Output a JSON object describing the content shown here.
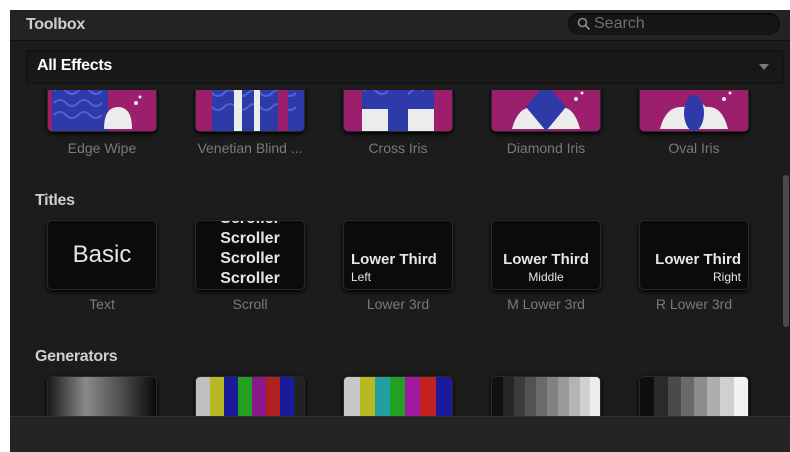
{
  "header": {
    "title": "Toolbox",
    "search_placeholder": "Search"
  },
  "filter": {
    "selected": "All Effects"
  },
  "transitions": [
    {
      "label": "Edge Wipe"
    },
    {
      "label": "Venetian Blind ..."
    },
    {
      "label": "Cross Iris"
    },
    {
      "label": "Diamond Iris"
    },
    {
      "label": "Oval Iris"
    }
  ],
  "sections": {
    "titles": "Titles",
    "generators": "Generators"
  },
  "titles": [
    {
      "label": "Text",
      "preview": "Basic"
    },
    {
      "label": "Scroll",
      "preview_lines": [
        "Scroller",
        "Scroller",
        "Scroller",
        "Scroller"
      ]
    },
    {
      "label": "Lower 3rd",
      "preview_main": "Lower Third",
      "preview_sub": "Left"
    },
    {
      "label": "M Lower 3rd",
      "preview_main": "Lower Third",
      "preview_sub": "Middle"
    },
    {
      "label": "R Lower 3rd",
      "preview_main": "Lower Third",
      "preview_sub": "Right"
    }
  ],
  "colors": {
    "transition_bg": "#9b1f6d",
    "transition_wave": "#2d3aa8",
    "panel": "#1c1c1c"
  }
}
